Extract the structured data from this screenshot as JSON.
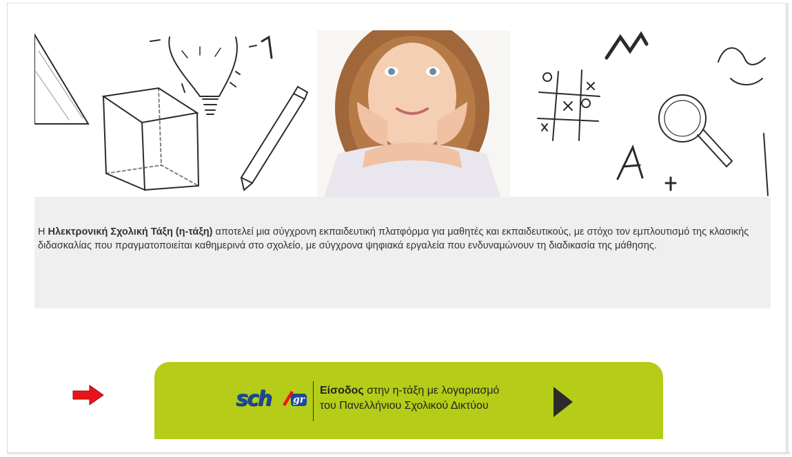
{
  "info": {
    "prefix": "Η ",
    "bold": "Ηλεκτρονική Σχολική Τάξη (η-τάξη)",
    "rest": " αποτελεί μια σύγχρονη εκπαιδευτική πλατφόρμα για μαθητές και εκπαιδευτικούς, με στόχο τον εμπλουτισμό της κλασικής διδασκαλίας που πραγματοποιείται καθημερινά στο σχολείο, με σύγχρονα ψηφιακά εργαλεία που ενδυναμώνουν τη διαδικασία της μάθησης."
  },
  "login": {
    "logo_text": "sch",
    "logo_suffix": "gr",
    "bold": "Είσοδος",
    "line1_rest": " στην η-τάξη με λογαριασμό",
    "line2": "του Πανελλήνιου Σχολικού Δικτύου"
  },
  "banner": {
    "letters": [
      "A",
      "+",
      "X",
      "O"
    ]
  },
  "colors": {
    "button_green": "#b5cc18",
    "arrow_red": "#e8141b",
    "info_bg": "#efefef",
    "logo_blue": "#1a4a9c"
  },
  "icons": {
    "pointer": "red-right-arrow-icon",
    "play": "play-triangle-icon"
  }
}
